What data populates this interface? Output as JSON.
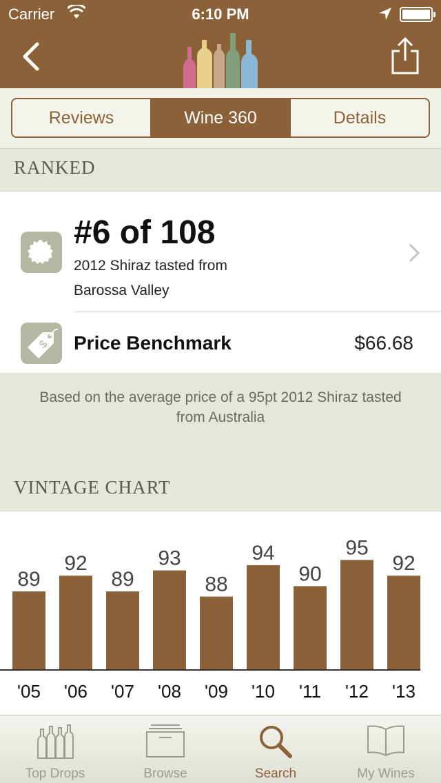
{
  "status_bar": {
    "carrier": "Carrier",
    "time": "6:10 PM"
  },
  "nav": {
    "back_icon": "chevron-left-icon",
    "share_icon": "share-icon",
    "logo_icon": "wine-bottles-logo"
  },
  "tabs": [
    {
      "label": "Reviews",
      "active": false
    },
    {
      "label": "Wine 360",
      "active": true
    },
    {
      "label": "Details",
      "active": false
    }
  ],
  "ranked": {
    "section_title": "RANKED",
    "rank": "#6 of 108",
    "subtitle": "2012 Shiraz tasted from Barossa Valley",
    "price_label": "Price Benchmark",
    "price_value": "$66.68",
    "note": "Based on the average price of a 95pt 2012 Shiraz tasted from Australia"
  },
  "vintage": {
    "section_title": "VINTAGE CHART"
  },
  "chart_data": {
    "type": "bar",
    "categories": [
      "'05",
      "'06",
      "'07",
      "'08",
      "'09",
      "'10",
      "'11",
      "'12",
      "'13"
    ],
    "values": [
      89,
      92,
      89,
      93,
      88,
      94,
      90,
      95,
      92
    ],
    "bar_color": "#8b6138",
    "data_labels": true,
    "grid": false
  },
  "tabbar": [
    {
      "label": "Top Drops",
      "icon": "bottles-icon",
      "active": false
    },
    {
      "label": "Browse",
      "icon": "box-icon",
      "active": false
    },
    {
      "label": "Search",
      "icon": "search-icon",
      "active": true
    },
    {
      "label": "My Wines",
      "icon": "book-icon",
      "active": false
    }
  ],
  "colors": {
    "brand": "#8b6138",
    "background": "#e6e6da",
    "icon_bg": "#b4b8a0"
  }
}
